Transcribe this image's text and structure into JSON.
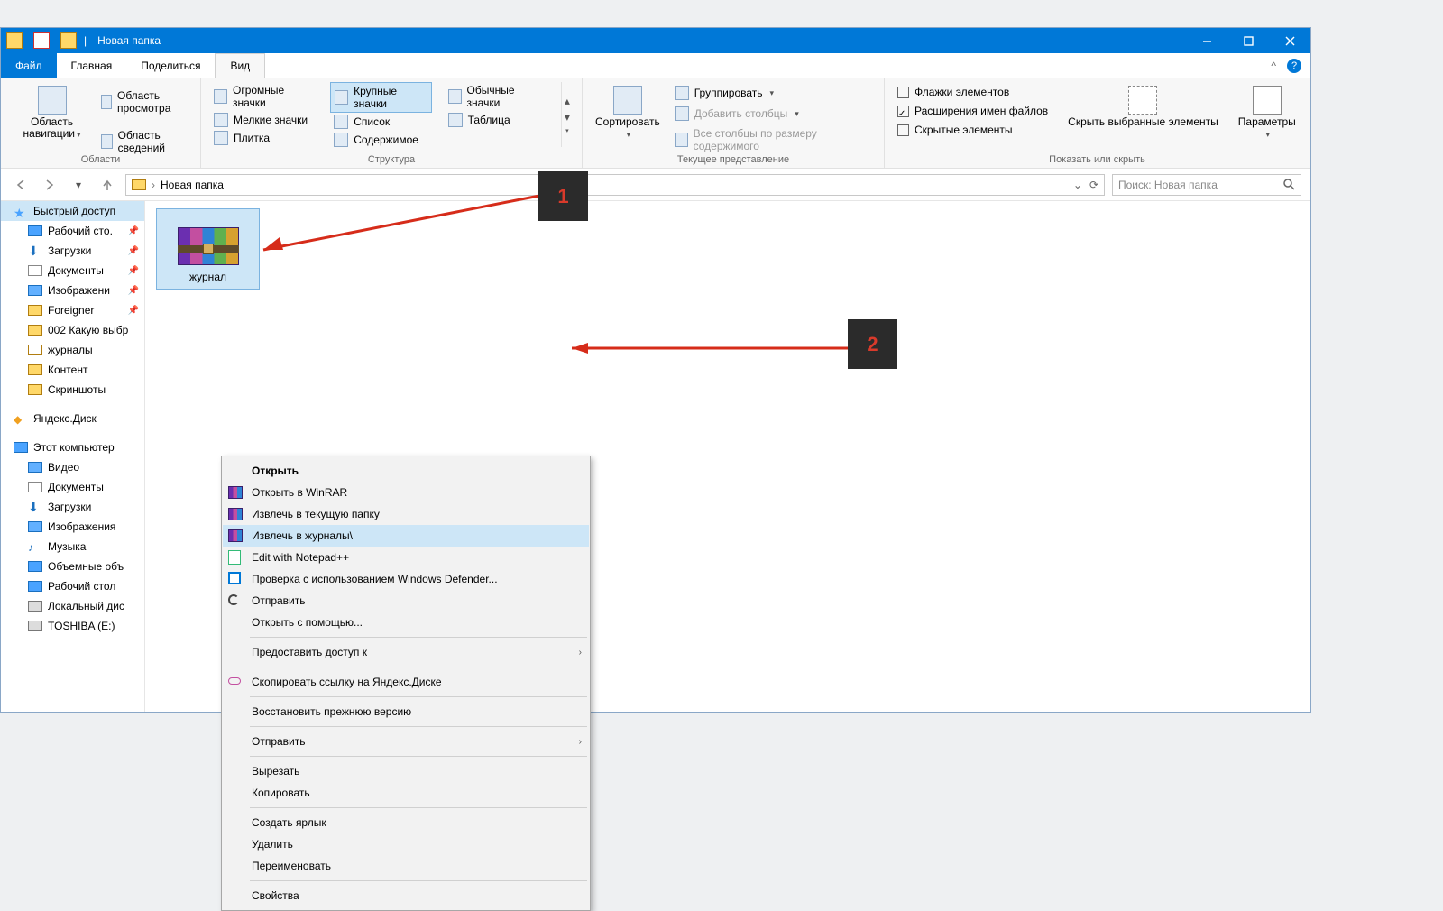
{
  "titlebar": {
    "title": "Новая папка"
  },
  "window_buttons": {
    "minimize": "–",
    "maximize": "❐",
    "close": "✕"
  },
  "tabs": {
    "file": "Файл",
    "home": "Главная",
    "share": "Поделиться",
    "view": "Вид"
  },
  "ribbon": {
    "areas": {
      "nav_pane": "Область навигации",
      "preview_pane": "Область просмотра",
      "details_pane": "Область сведений",
      "label": "Области"
    },
    "layout": {
      "xl": "Огромные значки",
      "lg": "Крупные значки",
      "md": "Обычные значки",
      "sm": "Мелкие значки",
      "list": "Список",
      "table": "Таблица",
      "tiles": "Плитка",
      "content": "Содержимое",
      "label": "Структура"
    },
    "view": {
      "sort": "Сортировать",
      "group": "Группировать",
      "add_cols": "Добавить столбцы",
      "size_cols": "Все столбцы по размеру содержимого",
      "label": "Текущее представление"
    },
    "showhide": {
      "checkboxes": "Флажки элементов",
      "ext": "Расширения имен файлов",
      "hidden": "Скрытые элементы",
      "hide_sel": "Скрыть выбранные элементы",
      "options": "Параметры",
      "label": "Показать или скрыть"
    }
  },
  "addressbar": {
    "path": "Новая папка",
    "refresh": "⟳"
  },
  "search": {
    "placeholder": "Поиск: Новая папка"
  },
  "sidebar": {
    "quick": "Быстрый доступ",
    "desktop": "Рабочий сто.",
    "downloads": "Загрузки",
    "documents": "Документы",
    "pictures": "Изображени",
    "foreigner": "Foreigner",
    "fold002": "002 Какую выбр",
    "journals": "журналы",
    "content": "Контент",
    "screens": "Скриншоты",
    "yandex": "Яндекс.Диск",
    "thispc": "Этот компьютер",
    "video": "Видео",
    "documents2": "Документы",
    "downloads2": "Загрузки",
    "pictures2": "Изображения",
    "music": "Музыка",
    "volumes": "Объемные объ",
    "desktop2": "Рабочий стол",
    "localdisk": "Локальный дис",
    "toshiba": "TOSHIBA (E:)"
  },
  "file": {
    "name": "журнал"
  },
  "context_menu": {
    "open": "Открыть",
    "open_winrar": "Открыть в WinRAR",
    "extract_here": "Извлечь в текущую папку",
    "extract_to": "Извлечь в журналы\\",
    "notepad": "Edit with Notepad++",
    "defender": "Проверка с использованием Windows Defender...",
    "send": "Отправить",
    "open_with": "Открыть с помощью...",
    "share": "Предоставить доступ к",
    "copy_yandex": "Скопировать ссылку на Яндекс.Диске",
    "restore": "Восстановить прежнюю версию",
    "send2": "Отправить",
    "cut": "Вырезать",
    "copy": "Копировать",
    "shortcut": "Создать ярлык",
    "delete": "Удалить",
    "rename": "Переименовать",
    "props": "Свойства"
  },
  "callouts": {
    "c1": "1",
    "c2": "2"
  }
}
